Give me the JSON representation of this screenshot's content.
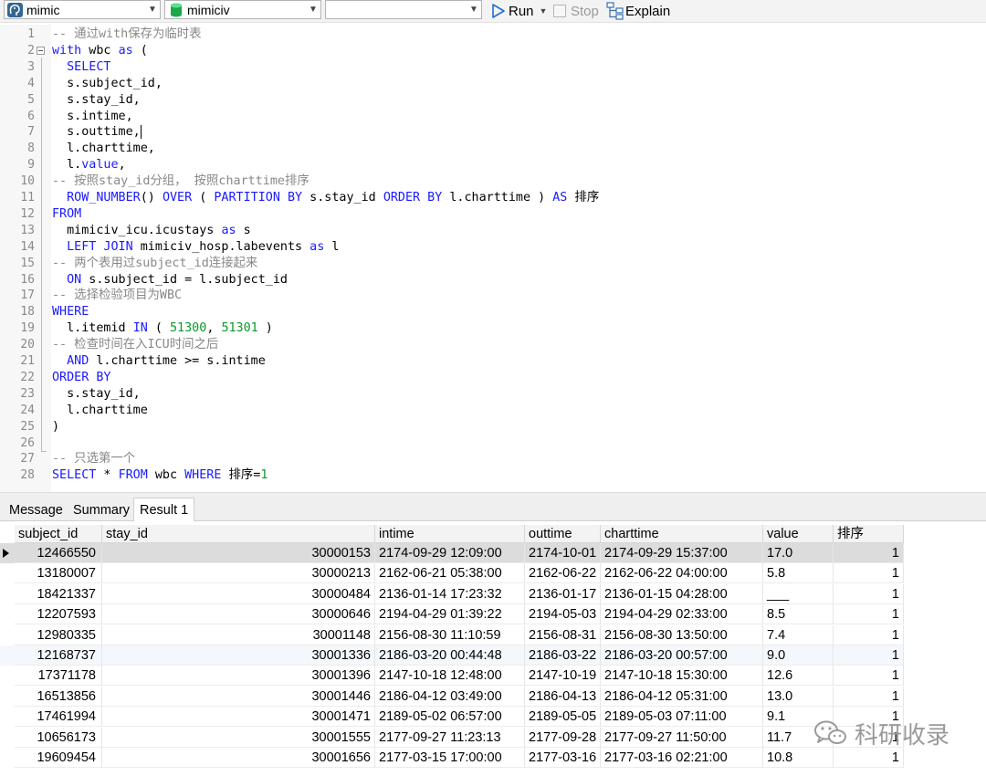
{
  "toolbar": {
    "connection": "mimic",
    "database": "mimiciv",
    "schema": "",
    "run_label": "Run",
    "stop_label": "Stop",
    "explain_label": "Explain"
  },
  "editor": {
    "lines": [
      {
        "n": "1",
        "tokens": [
          {
            "t": "-- 通过with保存为临时表",
            "c": "cm"
          }
        ]
      },
      {
        "n": "2",
        "tokens": [
          {
            "t": "with",
            "c": "kw"
          },
          {
            "t": " wbc "
          },
          {
            "t": "as",
            "c": "kw"
          },
          {
            "t": " ("
          }
        ]
      },
      {
        "n": "3",
        "tokens": [
          {
            "t": "  "
          },
          {
            "t": "SELECT",
            "c": "kw"
          }
        ]
      },
      {
        "n": "4",
        "tokens": [
          {
            "t": "  s.subject_id,"
          }
        ]
      },
      {
        "n": "5",
        "tokens": [
          {
            "t": "  s.stay_id,"
          }
        ]
      },
      {
        "n": "6",
        "tokens": [
          {
            "t": "  s.intime,"
          }
        ]
      },
      {
        "n": "7",
        "tokens": [
          {
            "t": "  s.outtime,"
          }
        ],
        "cursor": true
      },
      {
        "n": "8",
        "tokens": [
          {
            "t": "  l.charttime,"
          }
        ]
      },
      {
        "n": "9",
        "tokens": [
          {
            "t": "  l."
          },
          {
            "t": "value",
            "c": "kw"
          },
          {
            "t": ","
          }
        ]
      },
      {
        "n": "10",
        "tokens": [
          {
            "t": "-- 按照stay_id分组， 按照charttime排序",
            "c": "cm"
          }
        ]
      },
      {
        "n": "11",
        "tokens": [
          {
            "t": "  "
          },
          {
            "t": "ROW_NUMBER",
            "c": "kw"
          },
          {
            "t": "() "
          },
          {
            "t": "OVER",
            "c": "kw"
          },
          {
            "t": " ( "
          },
          {
            "t": "PARTITION BY",
            "c": "kw"
          },
          {
            "t": " s.stay_id "
          },
          {
            "t": "ORDER BY",
            "c": "kw"
          },
          {
            "t": " l.charttime ) "
          },
          {
            "t": "AS",
            "c": "kw"
          },
          {
            "t": " 排序"
          }
        ]
      },
      {
        "n": "12",
        "tokens": [
          {
            "t": "FROM",
            "c": "kw"
          }
        ]
      },
      {
        "n": "13",
        "tokens": [
          {
            "t": "  mimiciv_icu.icustays "
          },
          {
            "t": "as",
            "c": "kw"
          },
          {
            "t": " s"
          }
        ]
      },
      {
        "n": "14",
        "tokens": [
          {
            "t": "  "
          },
          {
            "t": "LEFT JOIN",
            "c": "kw"
          },
          {
            "t": " mimiciv_hosp.labevents "
          },
          {
            "t": "as",
            "c": "kw"
          },
          {
            "t": " l"
          }
        ]
      },
      {
        "n": "15",
        "tokens": [
          {
            "t": "-- 两个表用过subject_id连接起来",
            "c": "cm"
          }
        ]
      },
      {
        "n": "16",
        "tokens": [
          {
            "t": "  "
          },
          {
            "t": "ON",
            "c": "kw"
          },
          {
            "t": " s.subject_id = l.subject_id"
          }
        ]
      },
      {
        "n": "17",
        "tokens": [
          {
            "t": "-- 选择检验项目为WBC",
            "c": "cm"
          }
        ]
      },
      {
        "n": "18",
        "tokens": [
          {
            "t": "WHERE",
            "c": "kw"
          }
        ]
      },
      {
        "n": "19",
        "tokens": [
          {
            "t": "  l.itemid "
          },
          {
            "t": "IN",
            "c": "kw"
          },
          {
            "t": " ( "
          },
          {
            "t": "51300",
            "c": "num"
          },
          {
            "t": ", "
          },
          {
            "t": "51301",
            "c": "num"
          },
          {
            "t": " )"
          }
        ]
      },
      {
        "n": "20",
        "tokens": [
          {
            "t": "-- 检查时间在入ICU时间之后",
            "c": "cm"
          }
        ]
      },
      {
        "n": "21",
        "tokens": [
          {
            "t": "  "
          },
          {
            "t": "AND",
            "c": "kw"
          },
          {
            "t": " l.charttime >= s.intime"
          }
        ]
      },
      {
        "n": "22",
        "tokens": [
          {
            "t": "ORDER BY",
            "c": "kw"
          }
        ]
      },
      {
        "n": "23",
        "tokens": [
          {
            "t": "  s.stay_id,"
          }
        ]
      },
      {
        "n": "24",
        "tokens": [
          {
            "t": "  l.charttime"
          }
        ]
      },
      {
        "n": "25",
        "tokens": [
          {
            "t": ")"
          }
        ]
      },
      {
        "n": "26",
        "tokens": []
      },
      {
        "n": "27",
        "tokens": [
          {
            "t": "-- 只选第一个",
            "c": "cm"
          }
        ]
      },
      {
        "n": "28",
        "tokens": [
          {
            "t": "SELECT",
            "c": "kw"
          },
          {
            "t": " * "
          },
          {
            "t": "FROM",
            "c": "kw"
          },
          {
            "t": " wbc "
          },
          {
            "t": "WHERE",
            "c": "kw"
          },
          {
            "t": " 排序="
          },
          {
            "t": "1",
            "c": "num"
          }
        ]
      }
    ]
  },
  "tabs": {
    "message": "Message",
    "summary": "Summary",
    "result": "Result 1"
  },
  "grid": {
    "columns": [
      "subject_id",
      "stay_id",
      "intime",
      "outtime",
      "charttime",
      "value",
      "排序"
    ],
    "rows": [
      [
        "12466550",
        "30000153",
        "2174-09-29 12:09:00",
        "2174-10-01",
        "2174-09-29 15:37:00",
        "17.0",
        "1"
      ],
      [
        "13180007",
        "30000213",
        "2162-06-21 05:38:00",
        "2162-06-22",
        "2162-06-22 04:00:00",
        "5.8",
        "1"
      ],
      [
        "18421337",
        "30000484",
        "2136-01-14 17:23:32",
        "2136-01-17",
        "2136-01-15 04:28:00",
        "___",
        "1"
      ],
      [
        "12207593",
        "30000646",
        "2194-04-29 01:39:22",
        "2194-05-03",
        "2194-04-29 02:33:00",
        "8.5",
        "1"
      ],
      [
        "12980335",
        "30001148",
        "2156-08-30 11:10:59",
        "2156-08-31",
        "2156-08-30 13:50:00",
        "7.4",
        "1"
      ],
      [
        "12168737",
        "30001336",
        "2186-03-20 00:44:48",
        "2186-03-22",
        "2186-03-20 00:57:00",
        "9.0",
        "1"
      ],
      [
        "17371178",
        "30001396",
        "2147-10-18 12:48:00",
        "2147-10-19",
        "2147-10-18 15:30:00",
        "12.6",
        "1"
      ],
      [
        "16513856",
        "30001446",
        "2186-04-12 03:49:00",
        "2186-04-13",
        "2186-04-12 05:31:00",
        "13.0",
        "1"
      ],
      [
        "17461994",
        "30001471",
        "2189-05-02 06:57:00",
        "2189-05-05",
        "2189-05-03 07:11:00",
        "9.1",
        "1"
      ],
      [
        "10656173",
        "30001555",
        "2177-09-27 11:23:13",
        "2177-09-28",
        "2177-09-27 11:50:00",
        "11.7",
        "1"
      ],
      [
        "19609454",
        "30001656",
        "2177-03-15 17:00:00",
        "2177-03-16",
        "2177-03-16 02:21:00",
        "10.8",
        "1"
      ]
    ],
    "selected_row": 0
  },
  "watermark": "科研收录",
  "colors": {
    "keyword": "#1a1aff",
    "comment": "#888888",
    "number": "#0a9a2a",
    "run_icon": "#1f6fd1",
    "db_icon": "#1aa84a"
  },
  "icons": [
    "postgres-elephant-icon",
    "database-icon",
    "run-play-icon",
    "stop-icon",
    "explain-icon",
    "wechat-icon"
  ]
}
